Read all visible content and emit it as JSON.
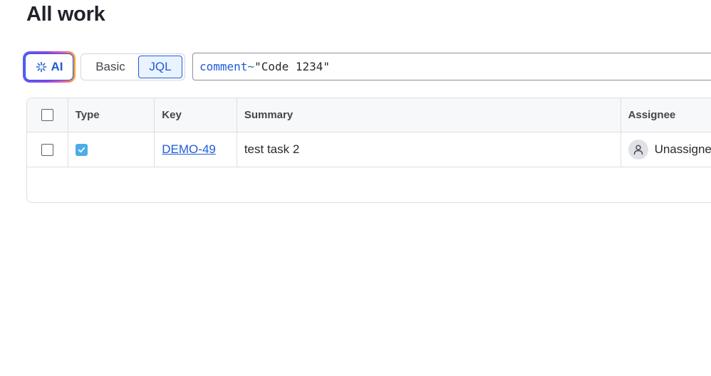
{
  "page": {
    "title": "All work"
  },
  "search": {
    "ai_label": "AI",
    "mode_basic_label": "Basic",
    "mode_jql_label": "JQL",
    "active_mode": "JQL",
    "jql_field": "comment",
    "jql_operator": "~",
    "jql_value": "\"Code 1234\""
  },
  "table": {
    "columns": [
      "Type",
      "Key",
      "Summary",
      "Assignee"
    ],
    "rows": [
      {
        "type_icon": "task-checkbox-icon",
        "key": "DEMO-49",
        "summary": "test task 2",
        "assignee": "Unassigned"
      }
    ]
  },
  "colors": {
    "accent": "#1f5bd8",
    "task_icon": "#4bade8",
    "ai_gradient": [
      "#5a5cf4",
      "#9b3ee8",
      "#e85aa8",
      "#f6a33a"
    ]
  }
}
